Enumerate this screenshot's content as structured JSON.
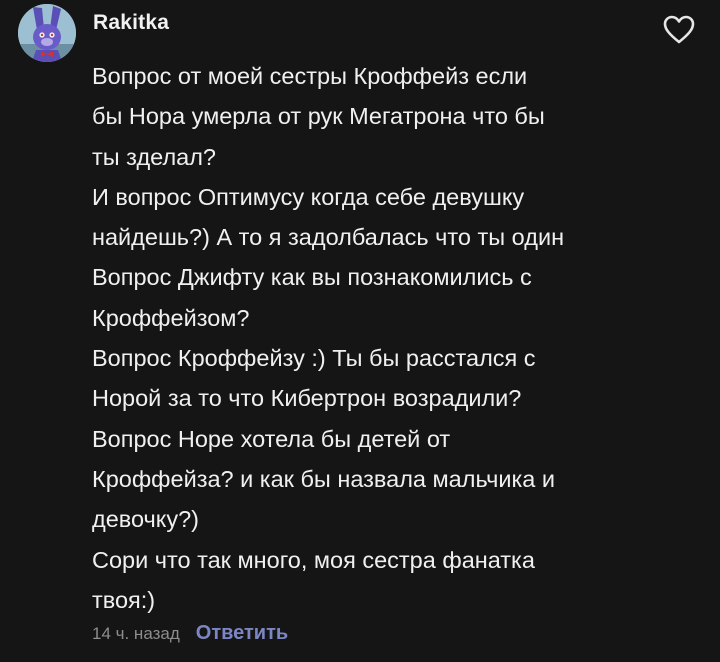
{
  "comment": {
    "author": "Rakitka",
    "avatar_icon": "purple-bunny-avatar-icon",
    "like_icon": "heart-outline-icon",
    "lines": [
      "Вопрос от моей сестры Кроффейз если",
      "бы Нора умерла от рук Мегатрона что бы",
      "ты зделал?",
      "И вопрос Оптимусу когда себе девушку",
      "найдешь?) А то я задолбалась что ты один",
      "Вопрос Джифту как вы познакомились с",
      "Кроффейзом?",
      "Вопрос Кроффейзу :) Ты бы расстался с",
      "Норой за то что Кибертрон возрадили?",
      "Вопрос Норе хотела бы детей от",
      "Кроффейза? и как бы назвала мальчика и",
      "девочку?)",
      "Сори что так много, моя сестра фанатка",
      "твоя:)"
    ],
    "timestamp": "14 ч. назад",
    "reply_label": "Ответить"
  },
  "colors": {
    "background": "#151515",
    "text": "#f0f0f0",
    "muted": "#8d8d8d",
    "accent": "#7d86c4"
  }
}
